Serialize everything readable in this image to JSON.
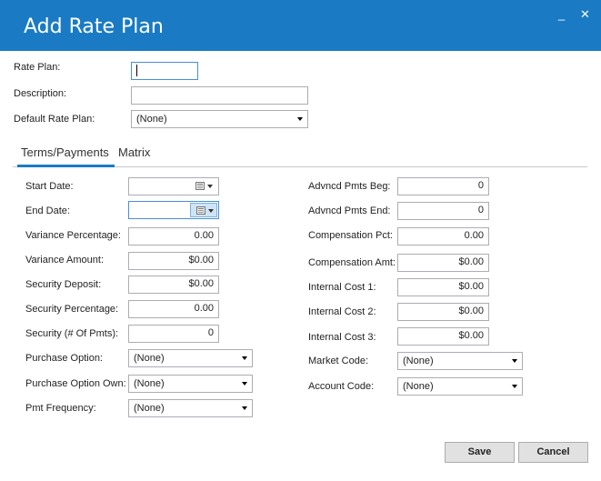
{
  "window": {
    "title": "Add Rate Plan",
    "minimize_label": "_",
    "close_label": "✕",
    "accent_color": "#1a7bc4"
  },
  "header_form": {
    "rate_plan": {
      "label": "Rate Plan:",
      "value": ""
    },
    "description": {
      "label": "Description:",
      "value": ""
    },
    "default_rate_plan": {
      "label": "Default  Rate Plan:",
      "value": "(None)"
    }
  },
  "tabs": [
    {
      "label": "Terms/Payments",
      "selected": true
    },
    {
      "label": "Matrix",
      "selected": false
    }
  ],
  "left_fields": {
    "start_date": {
      "label": "Start Date:",
      "value": ""
    },
    "end_date": {
      "label": "End Date:",
      "value": ""
    },
    "variance_percentage": {
      "label": "Variance Percentage:",
      "value": "0.00"
    },
    "variance_amount": {
      "label": "Variance Amount:",
      "value": "$0.00"
    },
    "security_deposit": {
      "label": "Security Deposit:",
      "value": "$0.00"
    },
    "security_percentage": {
      "label": "Security Percentage:",
      "value": "0.00"
    },
    "security_pmts": {
      "label": "Security (# Of Pmts):",
      "value": "0"
    },
    "purchase_option": {
      "label": "Purchase Option:",
      "value": "(None)"
    },
    "purchase_option_own": {
      "label": "Purchase Option Own:",
      "value": "(None)"
    },
    "pmt_frequency": {
      "label": "Pmt Frequency:",
      "value": "(None)"
    }
  },
  "right_fields": {
    "advncd_pmts_beg": {
      "label": "Advncd Pmts Beg:",
      "value": "0"
    },
    "advncd_pmts_end": {
      "label": "Advncd Pmts End:",
      "value": "0"
    },
    "compensation_pct": {
      "label": "Compensation Pct:",
      "value": "0.00"
    },
    "compensation_amt": {
      "label": "Compensation Amt:",
      "value": "$0.00"
    },
    "internal_cost_1": {
      "label": "Internal Cost 1:",
      "value": "$0.00"
    },
    "internal_cost_2": {
      "label": "Internal Cost 2:",
      "value": "$0.00"
    },
    "internal_cost_3": {
      "label": "Internal Cost 3:",
      "value": "$0.00"
    },
    "market_code": {
      "label": "Market Code:",
      "value": "(None)"
    },
    "account_code": {
      "label": "Account Code:",
      "value": "(None)"
    }
  },
  "buttons": {
    "save": "Save",
    "cancel": "Cancel"
  }
}
